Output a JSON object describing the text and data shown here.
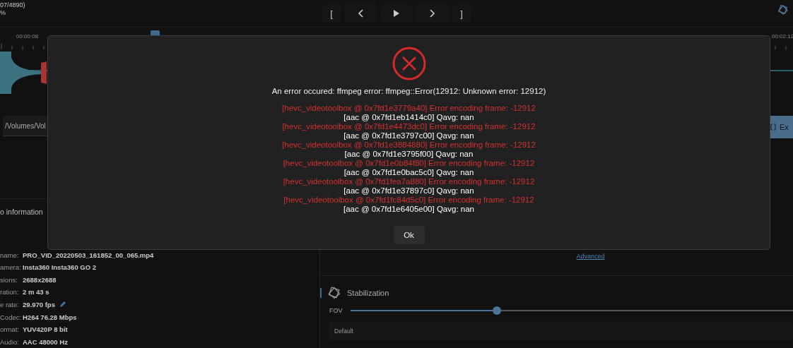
{
  "top_bar": {
    "frame_counter": "07/4890)",
    "percent": "%",
    "mark_in": "[",
    "mark_out": "]"
  },
  "timeline": {
    "labels": [
      "00:00:08",
      "00:02:12"
    ]
  },
  "path_field": {
    "value": "/Volumes/Vol"
  },
  "export_button": {
    "label": "Ex"
  },
  "info": {
    "title": "o information",
    "rows": [
      {
        "label": "name:",
        "value": "PRO_VID_20220503_161852_00_065.mp4",
        "editable": false
      },
      {
        "label": "amera:",
        "value": "Insta360 Insta360 GO 2",
        "editable": false
      },
      {
        "label": "sions:",
        "value": "2688x2688",
        "editable": false
      },
      {
        "label": "ration:",
        "value": "2 m 43 s",
        "editable": false
      },
      {
        "label": "e rate:",
        "value": "29.970 fps",
        "editable": true
      },
      {
        "label": "Codec:",
        "value": "H264 76.28 Mbps",
        "editable": false
      },
      {
        "label": "ormat:",
        "value": "YUV420P 8 bit",
        "editable": false
      },
      {
        "label": "Audio:",
        "value": "AAC 48000 Hz",
        "editable": false
      }
    ]
  },
  "advanced_link": "Advanced",
  "stabilization": {
    "title": "Stabilization",
    "fov": {
      "label": "FOV",
      "level": 0.33
    },
    "method": {
      "value": "Default"
    }
  },
  "dialog": {
    "message": "An error occured: ffmpeg error: ffmpeg::Error(12912: Unknown error: 12912)",
    "log": [
      {
        "kind": "error",
        "text": "[hevc_videotoolbox @ 0x7fd1e3779a40] Error encoding frame: -12912"
      },
      {
        "kind": "info",
        "text": "[aac @ 0x7fd1eb1414c0] Qavg: nan"
      },
      {
        "kind": "error",
        "text": "[hevc_videotoolbox @ 0x7fd1e4473dc0] Error encoding frame: -12912"
      },
      {
        "kind": "info",
        "text": "[aac @ 0x7fd1e3797c00] Qavg: nan"
      },
      {
        "kind": "error",
        "text": "[hevc_videotoolbox @ 0x7fd1e3884880] Error encoding frame: -12912"
      },
      {
        "kind": "info",
        "text": "[aac @ 0x7fd1e3795f00] Qavg: nan"
      },
      {
        "kind": "error",
        "text": "[hevc_videotoolbox @ 0x7fd1e0b84f80] Error encoding frame: -12912"
      },
      {
        "kind": "info",
        "text": "[aac @ 0x7fd1e0bac5c0] Qavg: nan"
      },
      {
        "kind": "error",
        "text": "[hevc_videotoolbox @ 0x7fd1fea7a880] Error encoding frame: -12912"
      },
      {
        "kind": "info",
        "text": "[aac @ 0x7fd1e37897c0] Qavg: nan"
      },
      {
        "kind": "error",
        "text": "[hevc_videotoolbox @ 0x7fd1fc84d5c0] Error encoding frame: -12912"
      },
      {
        "kind": "info",
        "text": "[aac @ 0x7fd1e6405e00] Qavg: nan"
      }
    ],
    "ok": "Ok"
  }
}
